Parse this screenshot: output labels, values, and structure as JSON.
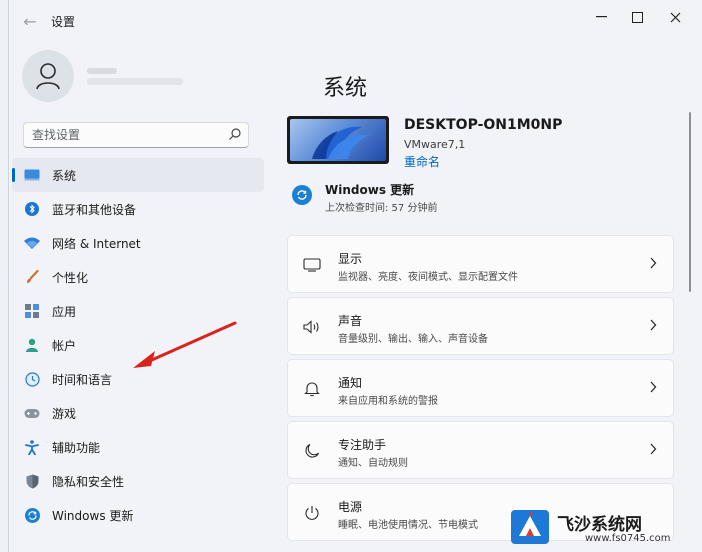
{
  "window": {
    "title": "设置"
  },
  "search": {
    "placeholder": "查找设置"
  },
  "nav": {
    "items": [
      {
        "label": "系统",
        "icon": "monitor-icon"
      },
      {
        "label": "蓝牙和其他设备",
        "icon": "bluetooth-icon"
      },
      {
        "label": "网络 & Internet",
        "icon": "wifi-icon"
      },
      {
        "label": "个性化",
        "icon": "brush-icon"
      },
      {
        "label": "应用",
        "icon": "apps-icon"
      },
      {
        "label": "帐户",
        "icon": "person-icon"
      },
      {
        "label": "时间和语言",
        "icon": "globe-clock-icon"
      },
      {
        "label": "游戏",
        "icon": "gamepad-icon"
      },
      {
        "label": "辅助功能",
        "icon": "accessibility-icon"
      },
      {
        "label": "隐私和安全性",
        "icon": "shield-icon"
      },
      {
        "label": "Windows 更新",
        "icon": "update-icon"
      }
    ],
    "active_index": 0
  },
  "main": {
    "title": "系统",
    "device": {
      "name": "DESKTOP-ON1M0NP",
      "model": "VMware7,1",
      "rename": "重命名"
    },
    "update": {
      "title": "Windows 更新",
      "subtitle": "上次检查时间: 57 分钟前"
    },
    "cards": [
      {
        "title": "显示",
        "subtitle": "监视器、亮度、夜间模式、显示配置文件",
        "icon": "display-icon"
      },
      {
        "title": "声音",
        "subtitle": "音量级别、输出、输入、声音设备",
        "icon": "speaker-icon"
      },
      {
        "title": "通知",
        "subtitle": "来自应用和系统的警报",
        "icon": "bell-icon"
      },
      {
        "title": "专注助手",
        "subtitle": "通知、自动规则",
        "icon": "moon-icon"
      },
      {
        "title": "电源",
        "subtitle": "睡眠、电池使用情况、节电模式",
        "icon": "power-icon"
      }
    ]
  },
  "watermark": {
    "title": "飞沙系统网",
    "url": "www.fs0745.com"
  },
  "colors": {
    "accent": "#0067c0",
    "background": "#f1f3f8",
    "card": "#fbfbfc",
    "arrow": "#d9241c"
  }
}
